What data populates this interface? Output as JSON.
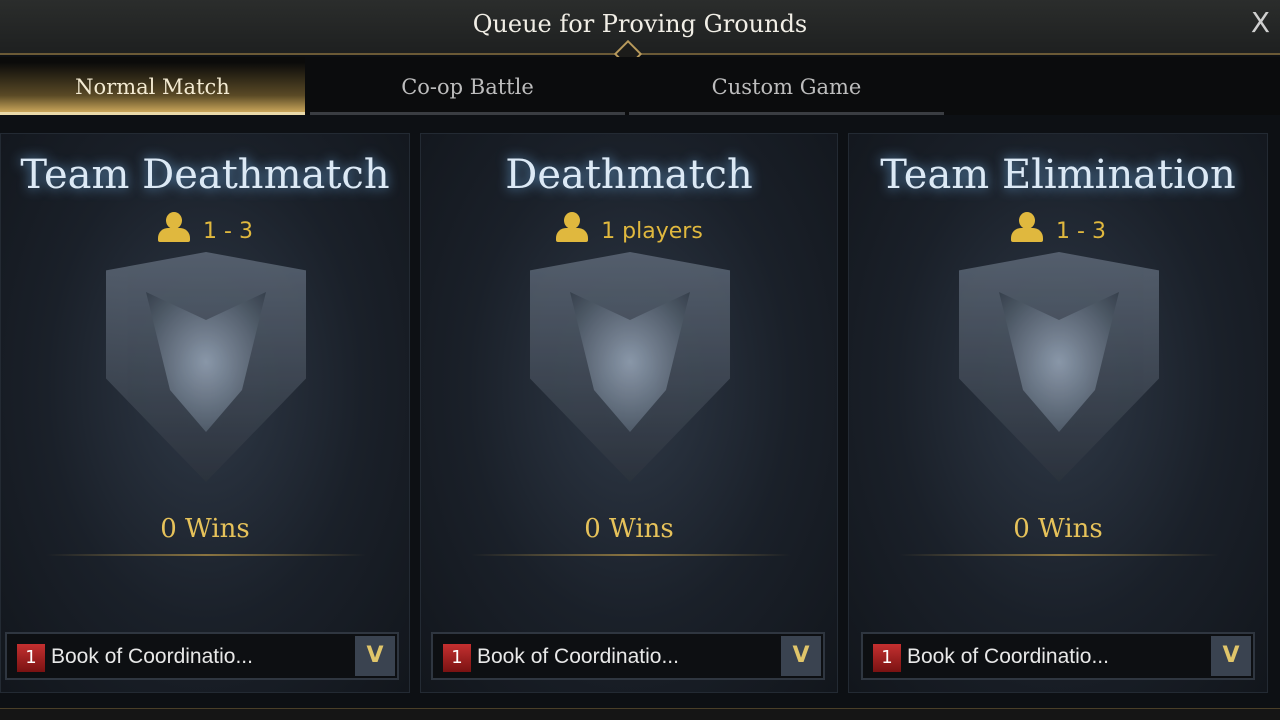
{
  "window": {
    "title": "Queue for Proving Grounds",
    "close_label": "X"
  },
  "tabs": [
    {
      "label": "Normal Match",
      "active": true
    },
    {
      "label": "Co-op Battle",
      "active": false
    },
    {
      "label": "Custom Game",
      "active": false
    }
  ],
  "modes": [
    {
      "name": "Team Deathmatch",
      "players": "1 - 3",
      "wins": "0 Wins",
      "item": {
        "count": "1",
        "label": "Book of Coordinatio..."
      }
    },
    {
      "name": "Deathmatch",
      "players": "1 players",
      "wins": "0 Wins",
      "item": {
        "count": "1",
        "label": "Book of Coordinatio..."
      }
    },
    {
      "name": "Team Elimination",
      "players": "1 - 3",
      "wins": "0 Wins",
      "item": {
        "count": "1",
        "label": "Book of Coordinatio..."
      }
    }
  ],
  "icons": {
    "player": "person-icon",
    "dropdown": "chevron-down-icon",
    "close": "close-icon"
  },
  "colors": {
    "accent_gold": "#e0b83e",
    "title_glow": "#6aa4d8",
    "badge_red": "#c43030"
  }
}
